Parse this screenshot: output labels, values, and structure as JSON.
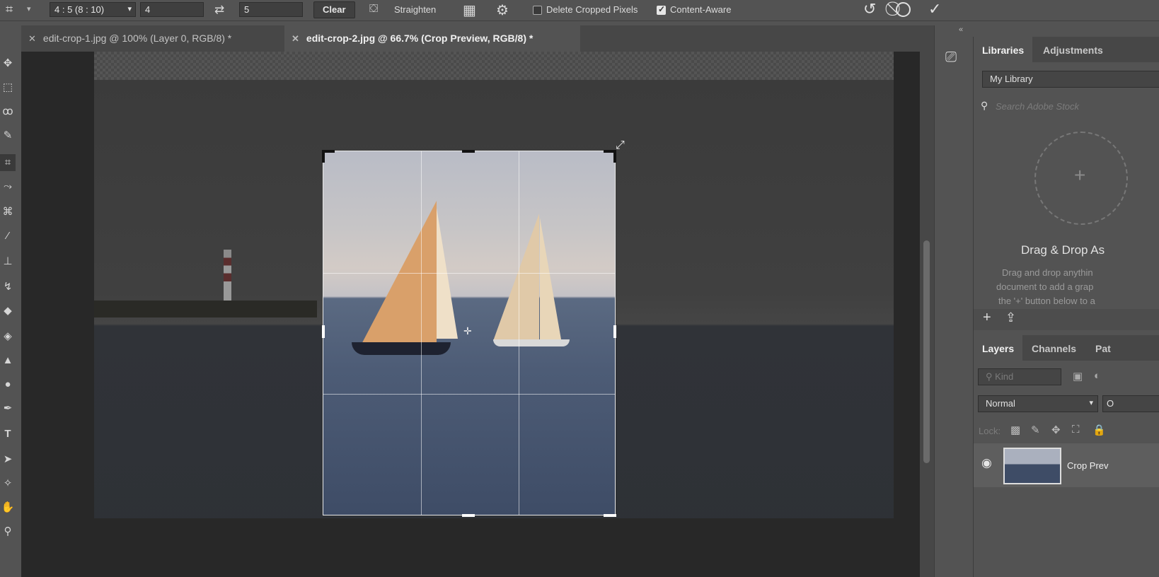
{
  "options_bar": {
    "ratio_preset": "4 : 5 (8 : 10)",
    "width_value": "4",
    "height_value": "5",
    "clear_label": "Clear",
    "straighten_label": "Straighten",
    "delete_cropped_label": "Delete Cropped Pixels",
    "delete_cropped_checked": false,
    "content_aware_label": "Content-Aware",
    "content_aware_checked": true
  },
  "tabs": [
    {
      "label": "edit-crop-1.jpg @ 100% (Layer 0, RGB/8) *",
      "active": false
    },
    {
      "label": "edit-crop-2.jpg @ 66.7% (Crop Preview, RGB/8) *",
      "active": true
    }
  ],
  "libraries_panel": {
    "tabs": [
      "Libraries",
      "Adjustments"
    ],
    "library_name": "My Library",
    "search_placeholder": "Search Adobe Stock",
    "drop_title": "Drag & Drop As",
    "drop_text": [
      "Drag and drop anythin",
      "document to add a grap",
      "the '+' button below to a"
    ]
  },
  "layers_panel": {
    "tabs": [
      "Layers",
      "Channels",
      "Pat"
    ],
    "filter_placeholder": "Kind",
    "blend_mode": "Normal",
    "blend_extra": "O",
    "lock_label": "Lock:",
    "layer_name": "Crop Prev"
  },
  "icons": [
    "crop-icon",
    "swap-icon",
    "straighten-icon",
    "grid-overlay-icon",
    "gear-icon",
    "reset-icon",
    "cancel-icon",
    "commit-icon",
    "move-icon",
    "marquee-icon",
    "lasso-icon",
    "quick-select-icon",
    "crop-tool-icon",
    "eyedropper-icon",
    "healing-icon",
    "brush-icon",
    "stamp-icon",
    "history-brush-icon",
    "eraser-icon",
    "gradient-icon",
    "blur-icon",
    "dodge-icon",
    "pen-icon",
    "type-icon",
    "path-select-icon",
    "shape-icon",
    "hand-icon",
    "zoom-icon",
    "eye-icon"
  ]
}
